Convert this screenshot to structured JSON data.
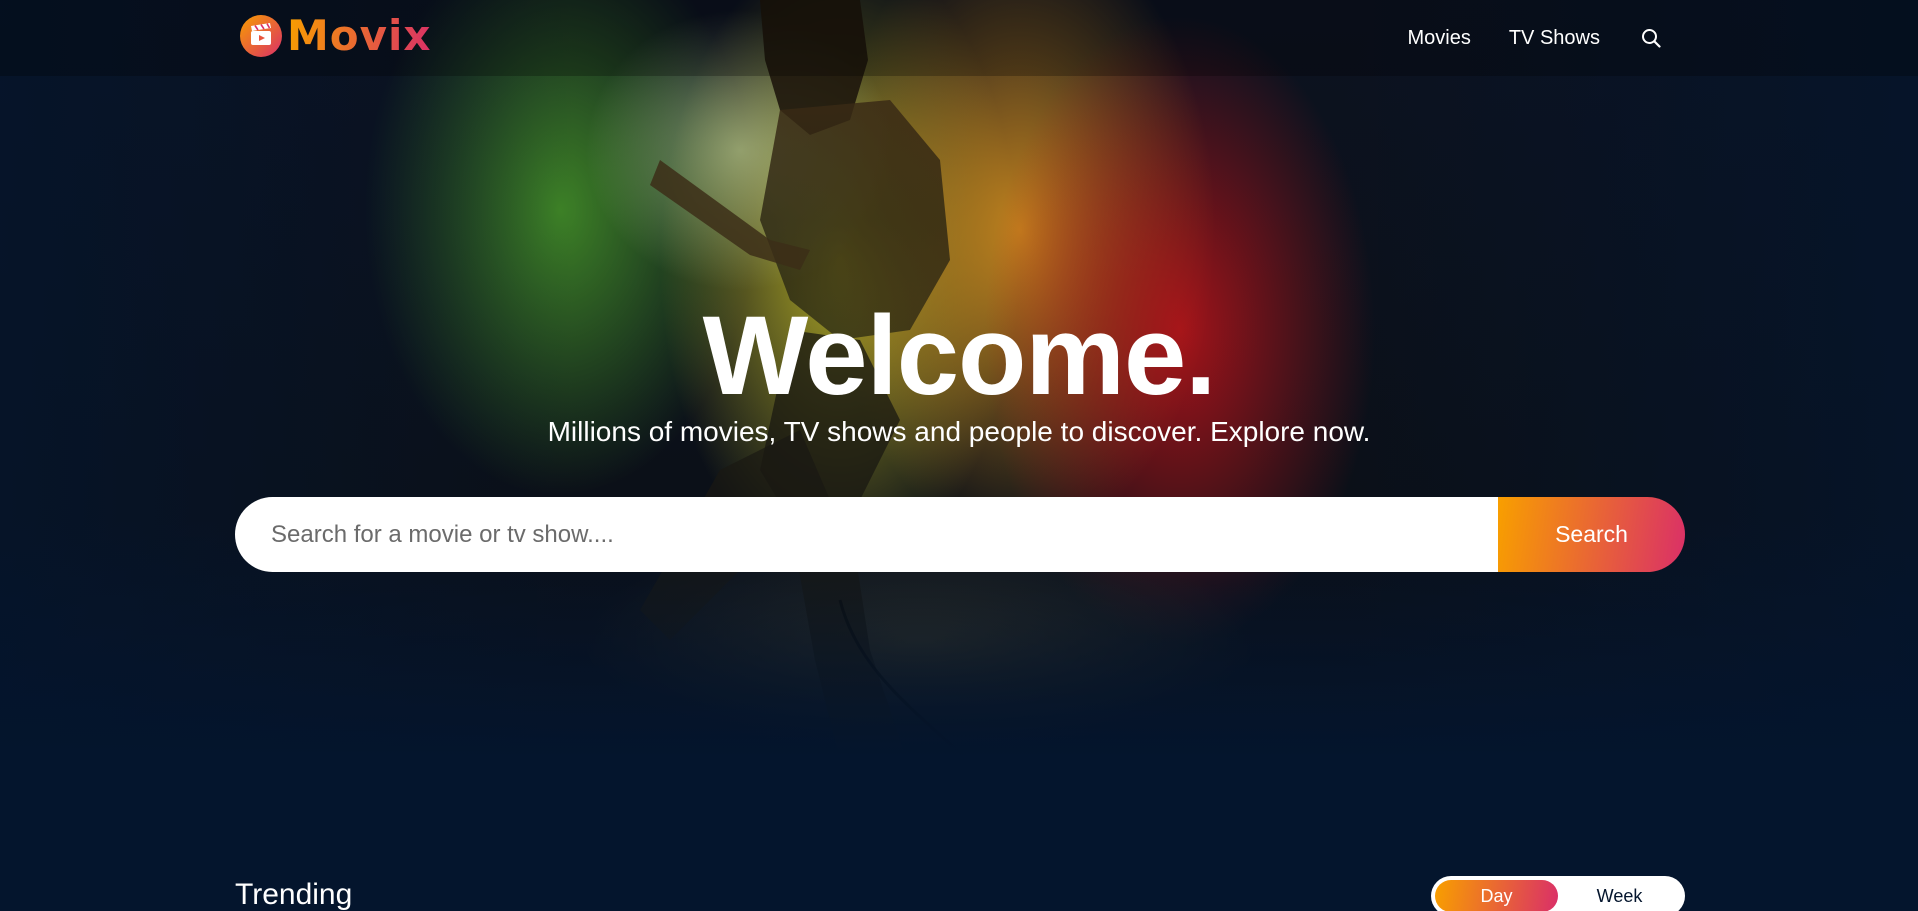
{
  "brand": {
    "name": "Movix",
    "accent_start": "#f89e00",
    "accent_end": "#da2f68"
  },
  "header": {
    "nav": [
      {
        "label": "Movies",
        "icon": ""
      },
      {
        "label": "TV Shows",
        "icon": ""
      }
    ],
    "search_icon": "search-icon"
  },
  "hero": {
    "title": "Welcome.",
    "subtitle": "Millions of movies, TV shows and people to discover. Explore now.",
    "search": {
      "placeholder": "Search for a movie or tv show....",
      "value": "",
      "button_label": "Search"
    }
  },
  "trending": {
    "title": "Trending",
    "tabs": [
      {
        "label": "Day",
        "active": true
      },
      {
        "label": "Week",
        "active": false
      }
    ]
  },
  "colors": {
    "page_background": "#04152d",
    "text": "#ffffff"
  }
}
